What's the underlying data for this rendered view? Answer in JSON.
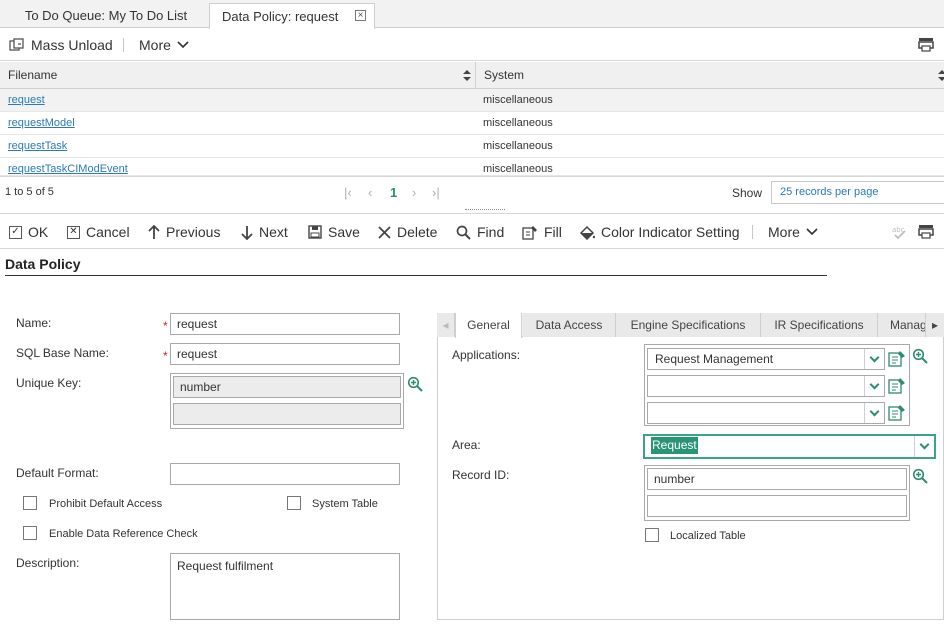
{
  "tabs": [
    {
      "label": "To Do Queue: My To Do List",
      "active": false
    },
    {
      "label": "Data Policy: request",
      "active": true
    }
  ],
  "toolbar1": {
    "mass_unload": "Mass Unload",
    "more": "More"
  },
  "grid": {
    "columns": [
      "Filename",
      "System"
    ],
    "rows": [
      {
        "filename": "request",
        "system": "miscellaneous"
      },
      {
        "filename": "requestModel",
        "system": "miscellaneous"
      },
      {
        "filename": "requestTask",
        "system": "miscellaneous"
      },
      {
        "filename": "requestTaskCIModEvent",
        "system": "miscellaneous"
      }
    ]
  },
  "pager": {
    "range": "1 to 5 of 5",
    "current_page": "1",
    "show_label": "Show",
    "per_page": "25 records per page"
  },
  "toolbar2": {
    "ok": "OK",
    "cancel": "Cancel",
    "previous": "Previous",
    "next": "Next",
    "save": "Save",
    "delete": "Delete",
    "find": "Find",
    "fill": "Fill",
    "color_indicator": "Color Indicator Setting",
    "more": "More"
  },
  "form": {
    "title": "Data Policy",
    "name_label": "Name:",
    "name_value": "request",
    "sql_label": "SQL Base Name:",
    "sql_value": "request",
    "unique_label": "Unique Key:",
    "unique_value_1": "number",
    "unique_value_2": "",
    "default_format_label": "Default Format:",
    "default_format_value": "",
    "prohibit_label": "Prohibit Default Access",
    "system_table_label": "System Table",
    "enable_ref_label": "Enable Data Reference Check",
    "description_label": "Description:",
    "description_value": "Request fulfilment",
    "required_mark": "*"
  },
  "right_tabs": [
    "General",
    "Data Access",
    "Engine Specifications",
    "IR Specifications",
    "Manag"
  ],
  "general": {
    "applications_label": "Applications:",
    "applications": [
      "Request Management",
      "",
      ""
    ],
    "area_label": "Area:",
    "area_value": "Request",
    "record_id_label": "Record ID:",
    "record_id_1": "number",
    "record_id_2": "",
    "localized_label": "Localized Table"
  },
  "colors": {
    "link": "#2a7ab8",
    "accent_green": "#2d8c6b",
    "page_active": "#2d8c6b"
  }
}
